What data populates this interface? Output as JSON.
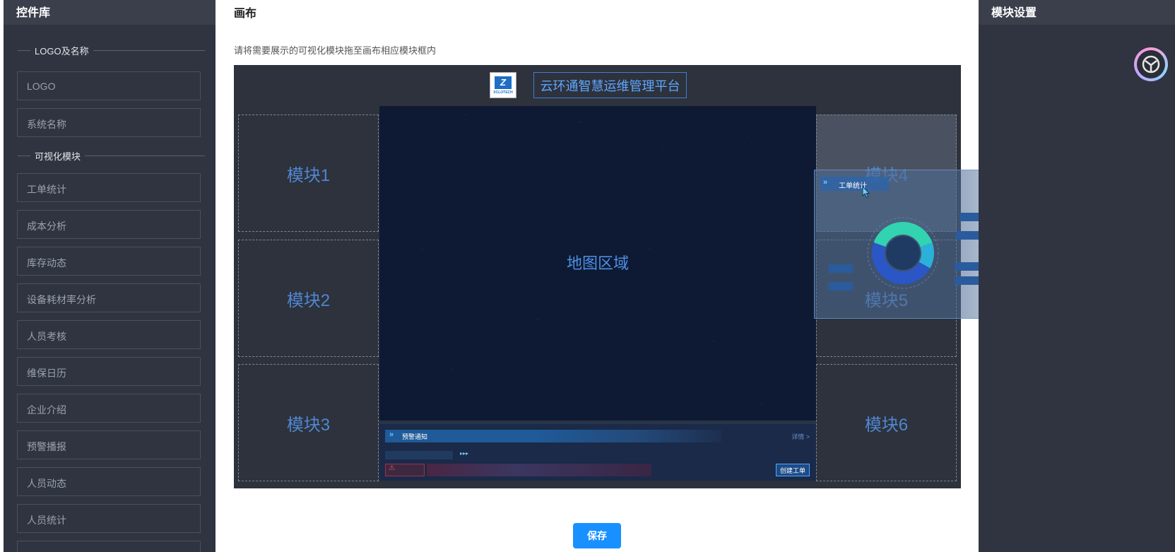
{
  "left_panel": {
    "title": "控件库",
    "sections": [
      {
        "label": "LOGO及名称",
        "items": [
          "LOGO",
          "系统名称"
        ]
      },
      {
        "label": "可视化模块",
        "items": [
          "工单统计",
          "成本分析",
          "库存动态",
          "设备耗材率分析",
          "人员考核",
          "维保日历",
          "企业介绍",
          "预警播报",
          "人员动态",
          "人员统计"
        ]
      }
    ]
  },
  "canvas_panel": {
    "title": "画布",
    "hint": "请将需要展示的可视化模块拖至画布相应模块框内",
    "logo_brand": "XCLOTECH",
    "system_name": "云环通智慧运维管理平台",
    "slots": [
      "模块1",
      "模块2",
      "模块3",
      "模块4",
      "模块5",
      "模块6"
    ],
    "map_label": "地图区域",
    "alert": {
      "title": "预警通知",
      "detail": "详情 >",
      "create_button": "创建工单",
      "warn_icon": "⚠"
    },
    "drag_ghost": {
      "title": "工单统计"
    },
    "save_label": "保存"
  },
  "right_panel": {
    "title": "模块设置"
  },
  "icons": {
    "chevrons": "»",
    "avatar": "user-avatar"
  },
  "colors": {
    "accent": "#1890ff",
    "panel_bg": "#2f3440",
    "canvas_bg": "#2d323c",
    "map_bg": "#0e1a33",
    "slot_text": "#4f86d1"
  }
}
